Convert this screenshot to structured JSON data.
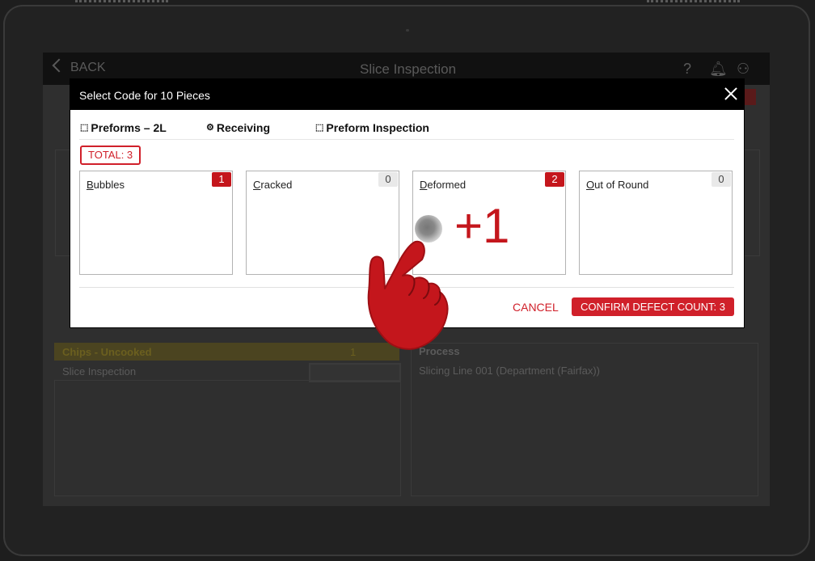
{
  "app": {
    "back_label": "BACK",
    "title": "Slice Inspection"
  },
  "background": {
    "item_title": "Chips - Uncooked",
    "item_count": "1",
    "item_row": "Slice Inspection",
    "process_title": "Process",
    "process_value": "Slicing Line 001 (Department (Fairfax))"
  },
  "dialog": {
    "title": "Select  Code for 10 Pieces",
    "crumbs": [
      {
        "icon": "box-icon",
        "label": "Preforms – 2L"
      },
      {
        "icon": "gear-icon",
        "label": "Receiving"
      },
      {
        "icon": "inspection-icon",
        "label": "Preform Inspection"
      }
    ],
    "total_label": "TOTAL: 3",
    "defects": [
      {
        "label_first": "B",
        "label_rest": "ubbles",
        "count": "1",
        "active": true
      },
      {
        "label_first": "C",
        "label_rest": "racked",
        "count": "0",
        "active": false
      },
      {
        "label_first": "D",
        "label_rest": "eformed",
        "count": "2",
        "active": true
      },
      {
        "label_first": "O",
        "label_rest": "ut of Round",
        "count": "0",
        "active": false
      }
    ],
    "cancel_label": "CANCEL",
    "confirm_label": "CONFIRM DEFECT COUNT: 3"
  },
  "gesture": {
    "increment_label": "+1"
  },
  "colors": {
    "accent": "#d0202a",
    "header": "#000000"
  }
}
